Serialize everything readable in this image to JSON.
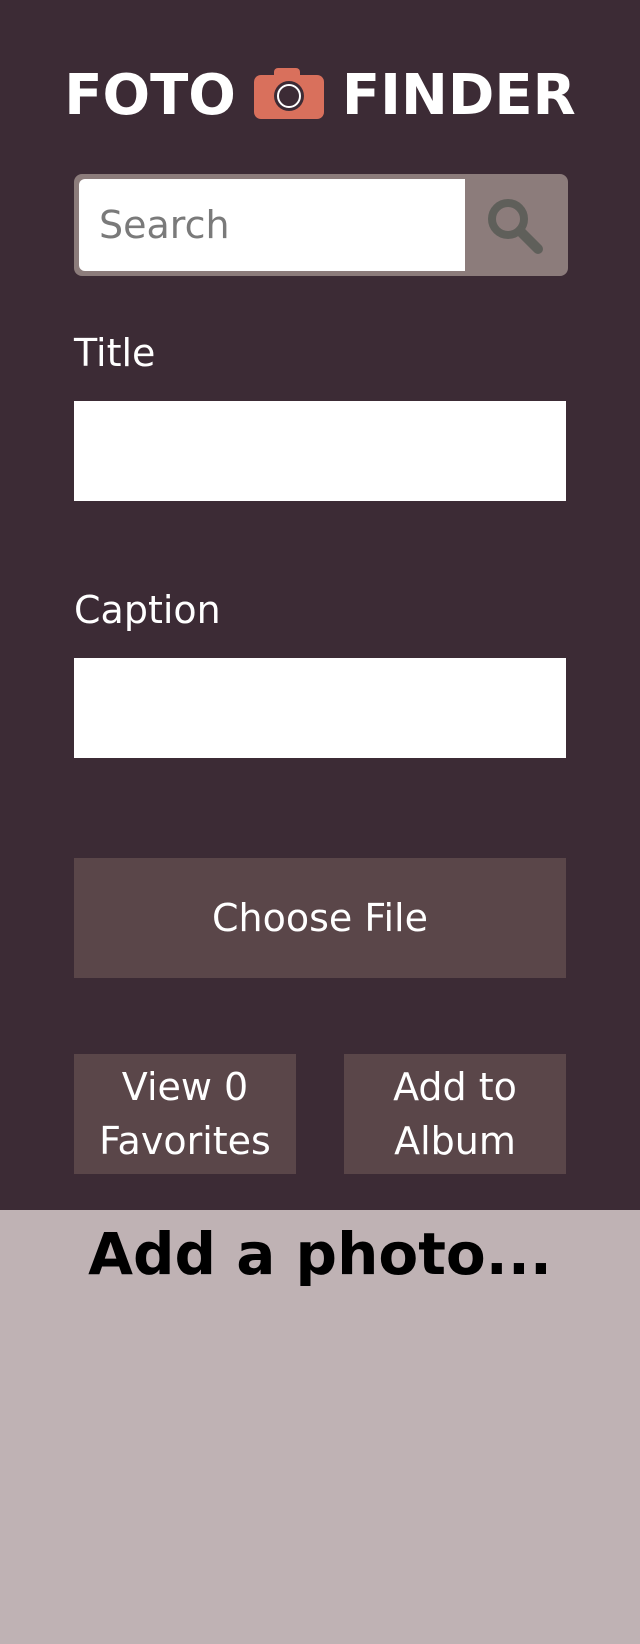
{
  "logo": {
    "word_left": "FOTO",
    "word_right": "FINDER",
    "icon": "camera-icon",
    "icon_color": "#d9705c"
  },
  "search": {
    "placeholder": "Search",
    "value": "",
    "button_icon": "search-icon"
  },
  "form": {
    "title_label": "Title",
    "title_value": "",
    "caption_label": "Caption",
    "caption_value": "",
    "choose_file_label": "Choose File"
  },
  "actions": {
    "favorites_label": "View 0 Favorites",
    "favorites_count": 0,
    "add_album_label": "Add to Album"
  },
  "main": {
    "empty_message": "Add a photo..."
  },
  "colors": {
    "panel_bg": "#3c2b35",
    "page_bg": "#bfb2b4",
    "button_bg": "#5a4649",
    "search_button_bg": "#8c7c7b"
  }
}
